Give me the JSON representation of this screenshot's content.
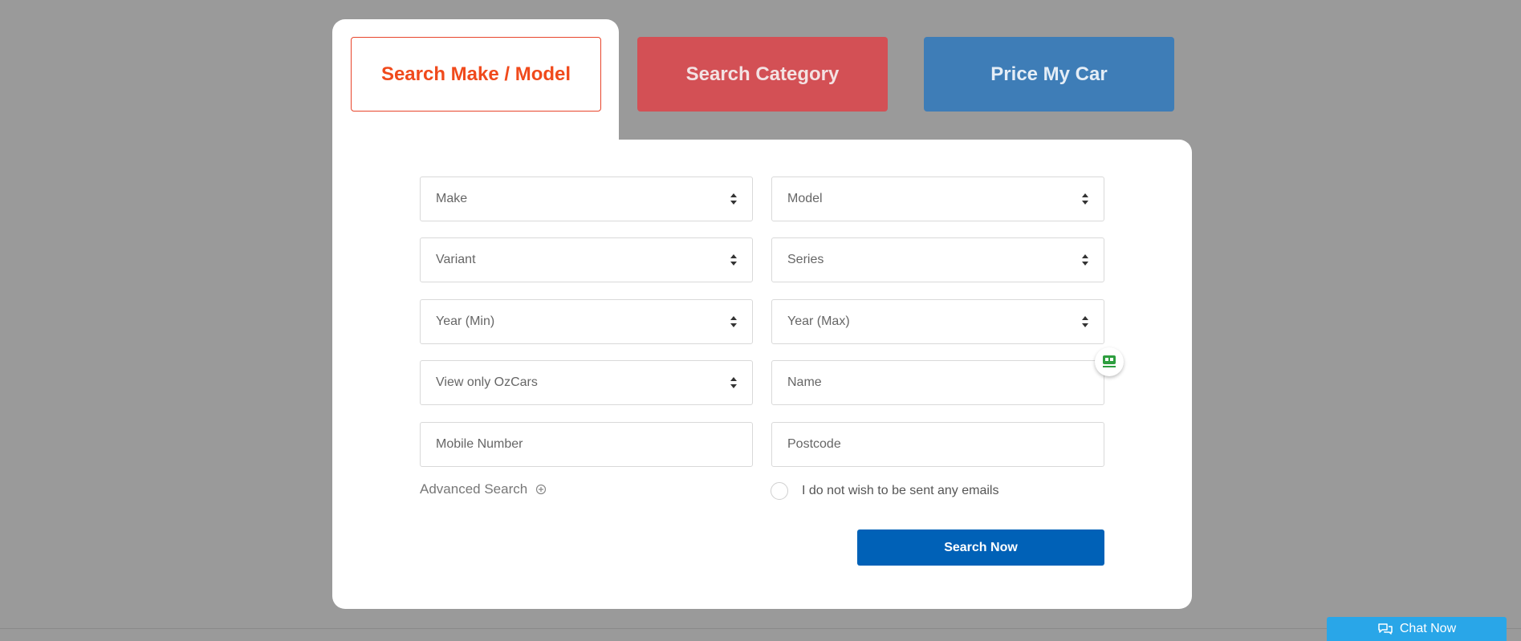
{
  "tabs": [
    {
      "label": "Search Make / Model",
      "active": true
    },
    {
      "label": "Search Category",
      "active": false
    },
    {
      "label": "Price My Car",
      "active": false
    }
  ],
  "form": {
    "make": "Make",
    "model": "Model",
    "variant": "Variant",
    "series": "Series",
    "year_min": "Year (Min)",
    "year_max": "Year (Max)",
    "view_only": "View only OzCars",
    "name_placeholder": "Name",
    "mobile_placeholder": "Mobile Number",
    "postcode_placeholder": "Postcode",
    "advanced_search": "Advanced Search",
    "no_emails_label": "I do not wish to be sent any emails",
    "search_button": "Search Now"
  },
  "chat": {
    "label": "Chat Now"
  },
  "colors": {
    "active_tab_text": "#f04a1c",
    "category_tab": "#d35055",
    "price_tab": "#3e7db7",
    "search_button": "#0061b7",
    "chat": "#29a6e8"
  }
}
